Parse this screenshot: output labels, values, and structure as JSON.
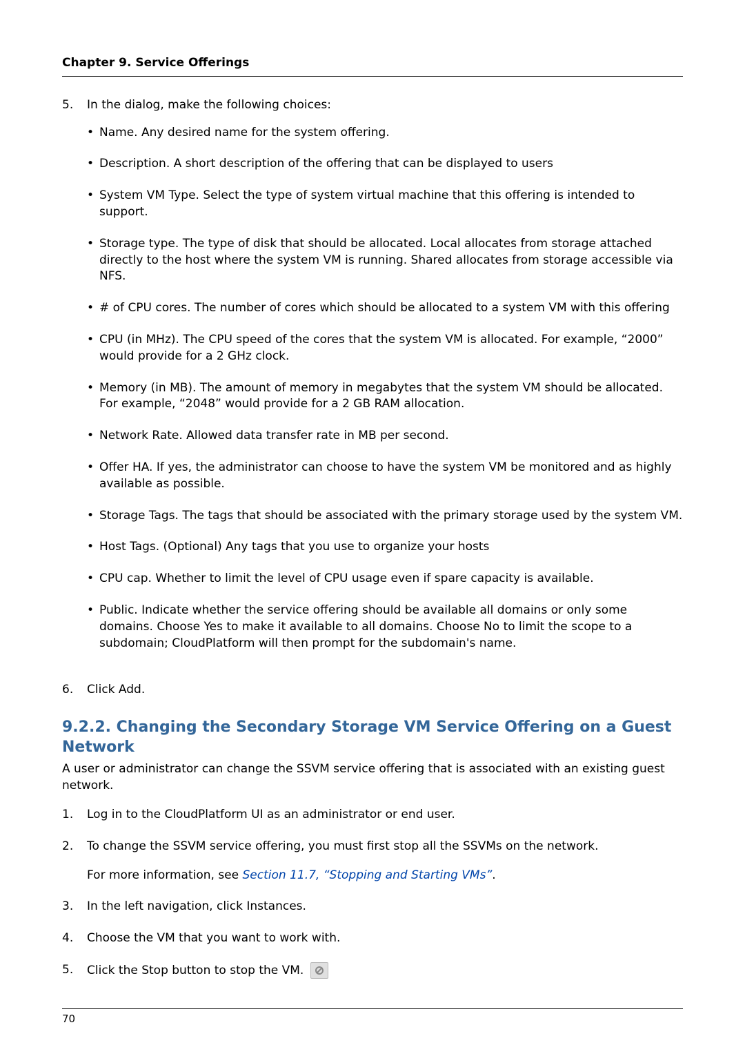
{
  "header": "Chapter 9. Service Offerings",
  "steps_top": {
    "5": {
      "num": "5.",
      "text": "In the dialog, make the following choices:",
      "bullets": [
        "Name. Any desired name for the system offering.",
        "Description. A short description of the offering that can be displayed to users",
        "System VM Type. Select the type of system virtual machine that this offering is intended to support.",
        "Storage type. The type of disk that should be allocated. Local allocates from storage attached directly to the host where the system VM is running. Shared allocates from storage accessible via NFS.",
        "# of CPU cores. The number of cores which should be allocated to a system VM with this offering",
        "CPU (in MHz). The CPU speed of the cores that the system VM is allocated. For example, “2000” would provide for a 2 GHz clock.",
        "Memory (in MB). The amount of memory in megabytes that the system VM should be allocated. For example, “2048” would provide for a 2 GB RAM allocation.",
        "Network Rate. Allowed data transfer rate in MB per second.",
        "Offer HA. If yes, the administrator can choose to have the system VM be monitored and as highly available as possible.",
        "Storage Tags. The tags that should be associated with the primary storage used by the system VM.",
        "Host Tags. (Optional) Any tags that you use to organize your hosts",
        "CPU cap. Whether to limit the level of CPU usage even if spare capacity is available.",
        "Public. Indicate whether the service offering should be available all domains or only some domains. Choose Yes to make it available to all domains. Choose No to limit the scope to a subdomain; CloudPlatform will then prompt for the subdomain's name."
      ]
    },
    "6": {
      "num": "6.",
      "text": "Click Add."
    }
  },
  "heading": "9.2.2. Changing the Secondary Storage VM Service Offering on a Guest Network",
  "intro": "A user or administrator can change the SSVM service offering that is associated with an existing guest network.",
  "steps_bottom": [
    {
      "num": "1.",
      "text": "Log in to the CloudPlatform UI as an administrator or end user."
    },
    {
      "num": "2.",
      "text": "To change the SSVM service offering, you must first stop all the SSVMs on the network.",
      "extra_pre": "For more information, see ",
      "extra_link": "Section 11.7, “Stopping and Starting VMs”",
      "extra_post": "."
    },
    {
      "num": "3.",
      "text": "In the left navigation, click Instances."
    },
    {
      "num": "4.",
      "text": "Choose the VM that you want to work with."
    },
    {
      "num": "5.",
      "text": "Click the Stop button to stop the VM.",
      "icon": true
    }
  ],
  "page_number": "70"
}
